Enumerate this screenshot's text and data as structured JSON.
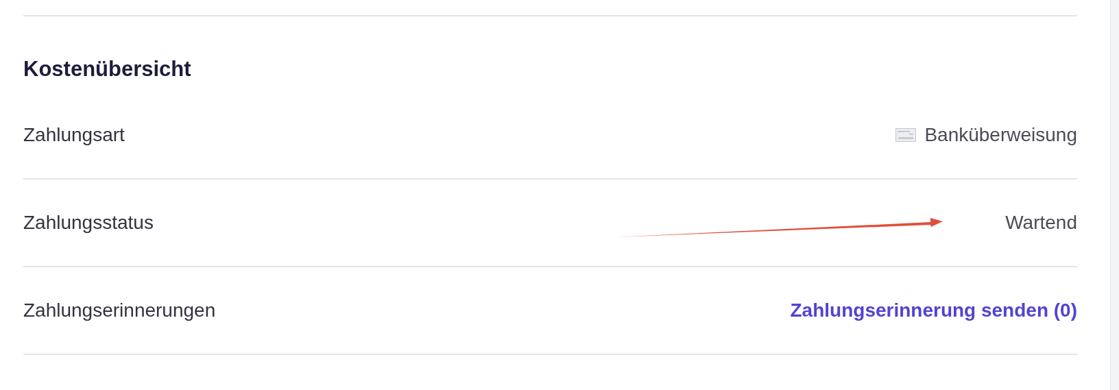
{
  "section": {
    "title": "Kostenübersicht"
  },
  "rows": [
    {
      "label": "Zahlungsart",
      "kind": "method",
      "value": "Banküberweisung"
    },
    {
      "label": "Zahlungsstatus",
      "kind": "text",
      "value": "Wartend"
    },
    {
      "label": "Zahlungserinnerungen",
      "kind": "link",
      "value": "Zahlungserinnerung senden (0)"
    }
  ]
}
